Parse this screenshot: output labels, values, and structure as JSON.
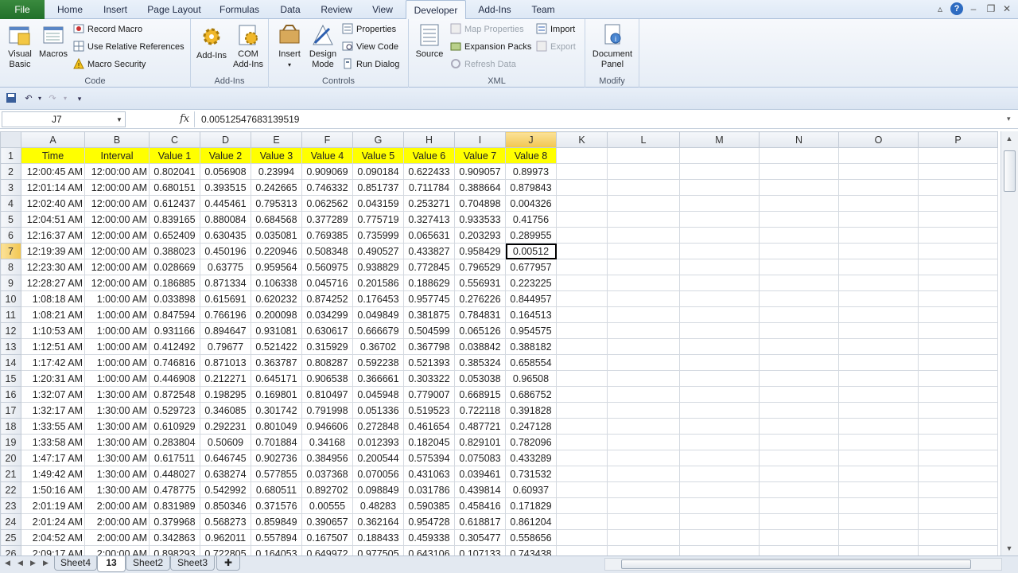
{
  "ribbon_tabs": {
    "file": "File",
    "tabs": [
      "Home",
      "Insert",
      "Page Layout",
      "Formulas",
      "Data",
      "Review",
      "View",
      "Developer",
      "Add-Ins",
      "Team"
    ],
    "active": "Developer"
  },
  "groups": {
    "code": {
      "label": "Code",
      "visual_basic": "Visual Basic",
      "macros": "Macros",
      "record_macro": "Record Macro",
      "use_relative": "Use Relative References",
      "macro_security": "Macro Security"
    },
    "addins": {
      "label": "Add-Ins",
      "addins": "Add-Ins",
      "com_addins": "COM Add-Ins"
    },
    "controls": {
      "label": "Controls",
      "insert": "Insert",
      "design_mode": "Design Mode",
      "properties": "Properties",
      "view_code": "View Code",
      "run_dialog": "Run Dialog"
    },
    "xml": {
      "label": "XML",
      "source": "Source",
      "map_properties": "Map Properties",
      "expansion_packs": "Expansion Packs",
      "refresh_data": "Refresh Data",
      "import": "Import",
      "export": "Export"
    },
    "modify": {
      "label": "Modify",
      "document_panel": "Document Panel"
    }
  },
  "formula_bar": {
    "cell_ref": "J7",
    "fx": "fx",
    "formula": "0.00512547683139519"
  },
  "columns": [
    "A",
    "B",
    "C",
    "D",
    "E",
    "F",
    "G",
    "H",
    "I",
    "J",
    "K",
    "L",
    "M",
    "N",
    "O",
    "P"
  ],
  "selected_column": "J",
  "selected_row": 7,
  "header_row": [
    "Time",
    "Interval",
    "Value 1",
    "Value 2",
    "Value 3",
    "Value 4",
    "Value 5",
    "Value 6",
    "Value 7",
    "Value 8"
  ],
  "rows": [
    [
      "12:00:45 AM",
      "12:00:00 AM",
      "0.802041",
      "0.056908",
      "0.23994",
      "0.909069",
      "0.090184",
      "0.622433",
      "0.909057",
      "0.89973"
    ],
    [
      "12:01:14 AM",
      "12:00:00 AM",
      "0.680151",
      "0.393515",
      "0.242665",
      "0.746332",
      "0.851737",
      "0.711784",
      "0.388664",
      "0.879843"
    ],
    [
      "12:02:40 AM",
      "12:00:00 AM",
      "0.612437",
      "0.445461",
      "0.795313",
      "0.062562",
      "0.043159",
      "0.253271",
      "0.704898",
      "0.004326"
    ],
    [
      "12:04:51 AM",
      "12:00:00 AM",
      "0.839165",
      "0.880084",
      "0.684568",
      "0.377289",
      "0.775719",
      "0.327413",
      "0.933533",
      "0.41756"
    ],
    [
      "12:16:37 AM",
      "12:00:00 AM",
      "0.652409",
      "0.630435",
      "0.035081",
      "0.769385",
      "0.735999",
      "0.065631",
      "0.203293",
      "0.289955"
    ],
    [
      "12:19:39 AM",
      "12:00:00 AM",
      "0.388023",
      "0.450196",
      "0.220946",
      "0.508348",
      "0.490527",
      "0.433827",
      "0.958429",
      "0.00512"
    ],
    [
      "12:23:30 AM",
      "12:00:00 AM",
      "0.028669",
      "0.63775",
      "0.959564",
      "0.560975",
      "0.938829",
      "0.772845",
      "0.796529",
      "0.677957"
    ],
    [
      "12:28:27 AM",
      "12:00:00 AM",
      "0.186885",
      "0.871334",
      "0.106338",
      "0.045716",
      "0.201586",
      "0.188629",
      "0.556931",
      "0.223225"
    ],
    [
      "1:08:18 AM",
      "1:00:00 AM",
      "0.033898",
      "0.615691",
      "0.620232",
      "0.874252",
      "0.176453",
      "0.957745",
      "0.276226",
      "0.844957"
    ],
    [
      "1:08:21 AM",
      "1:00:00 AM",
      "0.847594",
      "0.766196",
      "0.200098",
      "0.034299",
      "0.049849",
      "0.381875",
      "0.784831",
      "0.164513"
    ],
    [
      "1:10:53 AM",
      "1:00:00 AM",
      "0.931166",
      "0.894647",
      "0.931081",
      "0.630617",
      "0.666679",
      "0.504599",
      "0.065126",
      "0.954575"
    ],
    [
      "1:12:51 AM",
      "1:00:00 AM",
      "0.412492",
      "0.79677",
      "0.521422",
      "0.315929",
      "0.36702",
      "0.367798",
      "0.038842",
      "0.388182"
    ],
    [
      "1:17:42 AM",
      "1:00:00 AM",
      "0.746816",
      "0.871013",
      "0.363787",
      "0.808287",
      "0.592238",
      "0.521393",
      "0.385324",
      "0.658554"
    ],
    [
      "1:20:31 AM",
      "1:00:00 AM",
      "0.446908",
      "0.212271",
      "0.645171",
      "0.906538",
      "0.366661",
      "0.303322",
      "0.053038",
      "0.96508"
    ],
    [
      "1:32:07 AM",
      "1:30:00 AM",
      "0.872548",
      "0.198295",
      "0.169801",
      "0.810497",
      "0.045948",
      "0.779007",
      "0.668915",
      "0.686752"
    ],
    [
      "1:32:17 AM",
      "1:30:00 AM",
      "0.529723",
      "0.346085",
      "0.301742",
      "0.791998",
      "0.051336",
      "0.519523",
      "0.722118",
      "0.391828"
    ],
    [
      "1:33:55 AM",
      "1:30:00 AM",
      "0.610929",
      "0.292231",
      "0.801049",
      "0.946606",
      "0.272848",
      "0.461654",
      "0.487721",
      "0.247128"
    ],
    [
      "1:33:58 AM",
      "1:30:00 AM",
      "0.283804",
      "0.50609",
      "0.701884",
      "0.34168",
      "0.012393",
      "0.182045",
      "0.829101",
      "0.782096"
    ],
    [
      "1:47:17 AM",
      "1:30:00 AM",
      "0.617511",
      "0.646745",
      "0.902736",
      "0.384956",
      "0.200544",
      "0.575394",
      "0.075083",
      "0.433289"
    ],
    [
      "1:49:42 AM",
      "1:30:00 AM",
      "0.448027",
      "0.638274",
      "0.577855",
      "0.037368",
      "0.070056",
      "0.431063",
      "0.039461",
      "0.731532"
    ],
    [
      "1:50:16 AM",
      "1:30:00 AM",
      "0.478775",
      "0.542992",
      "0.680511",
      "0.892702",
      "0.098849",
      "0.031786",
      "0.439814",
      "0.60937"
    ],
    [
      "2:01:19 AM",
      "2:00:00 AM",
      "0.831989",
      "0.850346",
      "0.371576",
      "0.00555",
      "0.48283",
      "0.590385",
      "0.458416",
      "0.171829"
    ],
    [
      "2:01:24 AM",
      "2:00:00 AM",
      "0.379968",
      "0.568273",
      "0.859849",
      "0.390657",
      "0.362164",
      "0.954728",
      "0.618817",
      "0.861204"
    ],
    [
      "2:04:52 AM",
      "2:00:00 AM",
      "0.342863",
      "0.962011",
      "0.557894",
      "0.167507",
      "0.188433",
      "0.459338",
      "0.305477",
      "0.558656"
    ],
    [
      "2:09:17 AM",
      "2:00:00 AM",
      "0.898293",
      "0.722805",
      "0.164053",
      "0.649972",
      "0.977505",
      "0.643106",
      "0.107133",
      "0.743438"
    ]
  ],
  "sheet_tabs": [
    "Sheet4",
    "13",
    "Sheet2",
    "Sheet3"
  ],
  "active_sheet": "13",
  "colors": {
    "header_fill": "#ffff00",
    "file_tab": "#2b7a32",
    "selection": "#f2c650"
  }
}
